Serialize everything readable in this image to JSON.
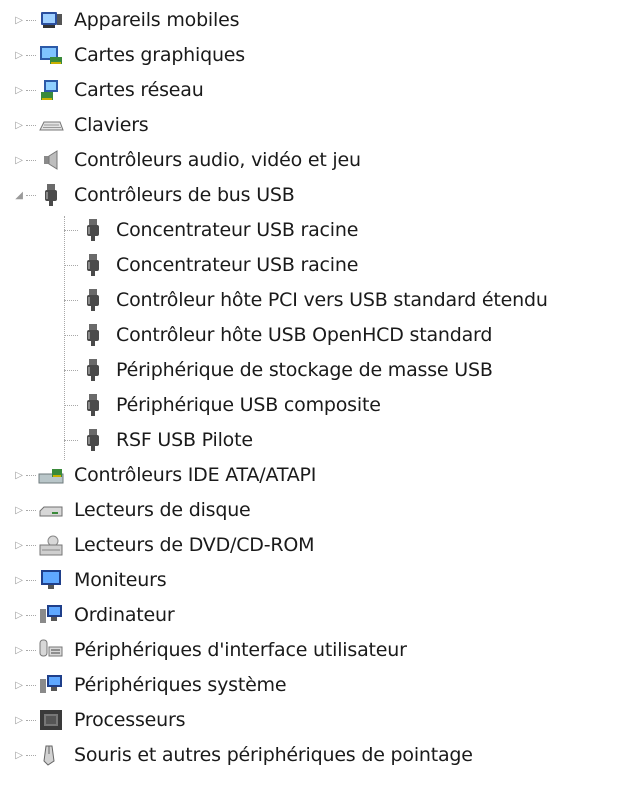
{
  "categories_before": [
    {
      "label": "Appareils mobiles",
      "icon": "mobile-devices-icon"
    },
    {
      "label": "Cartes graphiques",
      "icon": "display-adapter-icon"
    },
    {
      "label": "Cartes réseau",
      "icon": "network-adapter-icon"
    },
    {
      "label": "Claviers",
      "icon": "keyboard-icon"
    },
    {
      "label": "Contrôleurs audio, vidéo et jeu",
      "icon": "speaker-icon"
    }
  ],
  "expanded_category": {
    "label": "Contrôleurs de bus USB",
    "icon": "usb-plug-icon"
  },
  "usb_children": [
    {
      "label": "Concentrateur USB racine"
    },
    {
      "label": "Concentrateur USB racine"
    },
    {
      "label": "Contrôleur hôte PCI vers USB standard étendu"
    },
    {
      "label": "Contrôleur hôte USB OpenHCD standard"
    },
    {
      "label": "Périphérique de stockage de masse USB"
    },
    {
      "label": "Périphérique USB composite"
    },
    {
      "label": "RSF USB Pilote"
    }
  ],
  "categories_after": [
    {
      "label": "Contrôleurs IDE ATA/ATAPI",
      "icon": "ide-controller-icon"
    },
    {
      "label": "Lecteurs de disque",
      "icon": "disk-drive-icon"
    },
    {
      "label": "Lecteurs de DVD/CD-ROM",
      "icon": "dvd-drive-icon"
    },
    {
      "label": "Moniteurs",
      "icon": "monitor-icon"
    },
    {
      "label": "Ordinateur",
      "icon": "computer-icon"
    },
    {
      "label": "Périphériques d'interface utilisateur",
      "icon": "hid-icon"
    },
    {
      "label": "Périphériques système",
      "icon": "system-devices-icon"
    },
    {
      "label": "Processeurs",
      "icon": "processor-icon"
    },
    {
      "label": "Souris et autres périphériques de pointage",
      "icon": "mouse-icon"
    }
  ],
  "colors": {
    "text": "#1a1a1a",
    "expander": "#9a9a9a",
    "tree_lines": "#a8a8a8"
  }
}
